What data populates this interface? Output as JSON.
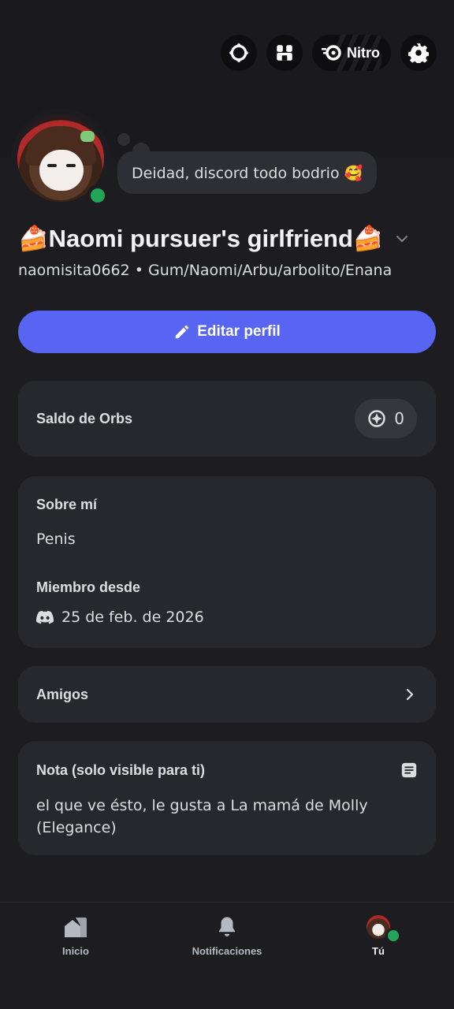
{
  "header": {
    "nitro_label": "Nitro",
    "icons": [
      "quests-icon",
      "shop-icon",
      "nitro-icon",
      "gear-icon"
    ]
  },
  "profile": {
    "custom_status": "Deidad, discord todo bodrio 🥰",
    "display_name": "🍰Naomi pursuer's girlfriend🍰",
    "username": "naomisita0662",
    "pronouns": "Gum/Naomi/Arbu/arbolito/Enana",
    "online_color": "#23a559"
  },
  "actions": {
    "edit_profile": "Editar perfil"
  },
  "orbs": {
    "title": "Saldo de Orbs",
    "balance": "0"
  },
  "about": {
    "title": "Sobre mí",
    "text": "Penis",
    "member_title": "Miembro desde",
    "member_date": "25 de feb. de 2026"
  },
  "friends": {
    "title": "Amigos"
  },
  "note": {
    "title": "Nota (solo visible para ti)",
    "text": "el que ve ésto, le gusta a La mamá de Molly (Elegance)"
  },
  "tabs": [
    {
      "label": "Inicio",
      "icon": "home-icon"
    },
    {
      "label": "Notificaciones",
      "icon": "bell-icon"
    },
    {
      "label": "Tú",
      "icon": "avatar"
    }
  ],
  "colors": {
    "accent": "#5865f2",
    "background": "#1c1c21",
    "card": "#27282d"
  }
}
